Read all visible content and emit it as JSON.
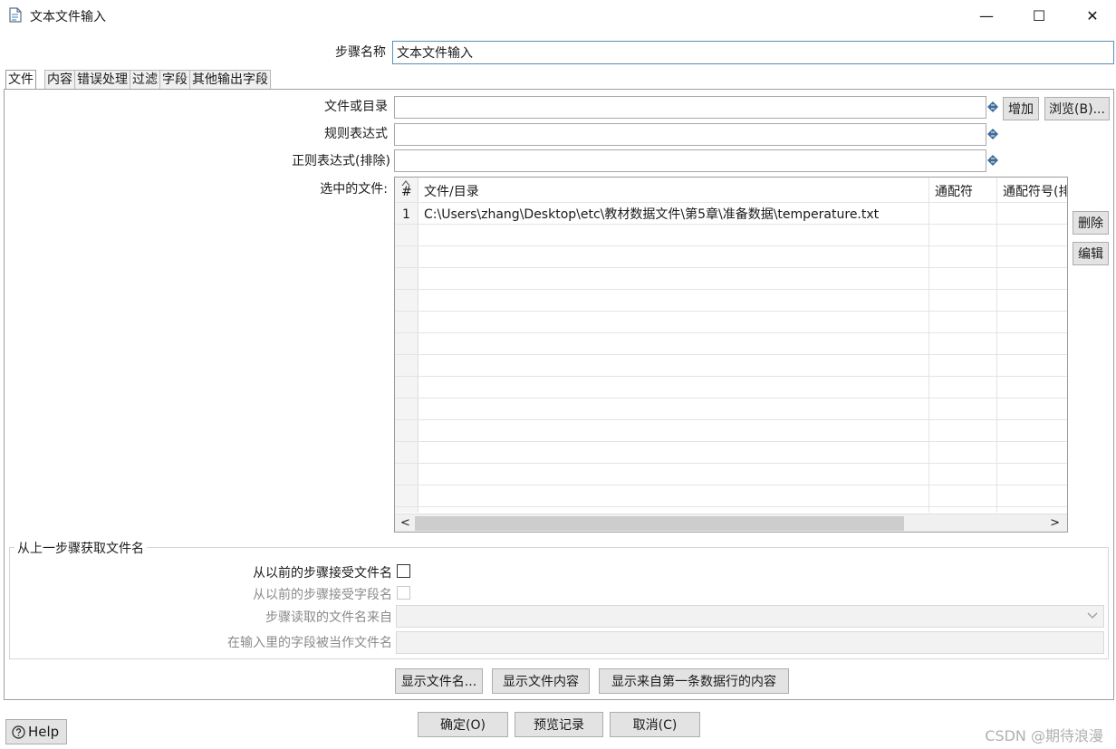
{
  "window": {
    "title": "文本文件输入",
    "minimize": "—",
    "maximize": "☐",
    "close": "✕"
  },
  "step_name": {
    "label": "步骤名称",
    "value": "文本文件输入"
  },
  "tabs": [
    {
      "label": "文件",
      "active": true
    },
    {
      "label": "内容"
    },
    {
      "label": "错误处理"
    },
    {
      "label": "过滤"
    },
    {
      "label": "字段"
    },
    {
      "label": "其他输出字段"
    }
  ],
  "file_tab": {
    "file_or_dir_label": "文件或目录",
    "file_or_dir_value": "",
    "regex_label": "规则表达式",
    "regex_value": "",
    "regex_exclude_label": "正则表达式(排除)",
    "regex_exclude_value": "",
    "add_button": "增加",
    "browse_button": "浏览(B)...",
    "selected_files_label": "选中的文件:",
    "delete_button": "删除",
    "edit_button": "编辑"
  },
  "files_table": {
    "columns": [
      "#",
      "文件/目录",
      "通配符",
      "通配符号(排"
    ],
    "rows": [
      {
        "num": "1",
        "path": "C:\\Users\\zhang\\Desktop\\etc\\教材数据文件\\第5章\\准备数据\\temperature.txt",
        "wildcard": "",
        "wildcard_exclude": ""
      }
    ],
    "scroll_left": "<",
    "scroll_right": ">"
  },
  "prev_step_group": {
    "title": "从上一步骤获取文件名",
    "accept_filenames_label": "从以前的步骤接受文件名",
    "accept_fields_label": "从以前的步骤接受字段名",
    "source_step_label": "步骤读取的文件名来自",
    "source_step_value": "",
    "field_as_filename_label": "在输入里的字段被当作文件名",
    "field_as_filename_value": ""
  },
  "show_buttons": {
    "show_filenames": "显示文件名...",
    "show_file_content": "显示文件内容",
    "show_first_row": "显示来自第一条数据行的内容"
  },
  "footer": {
    "help": "Help",
    "ok": "确定(O)",
    "preview": "预览记录",
    "cancel": "取消(C)",
    "watermark": "CSDN @期待浪漫"
  }
}
